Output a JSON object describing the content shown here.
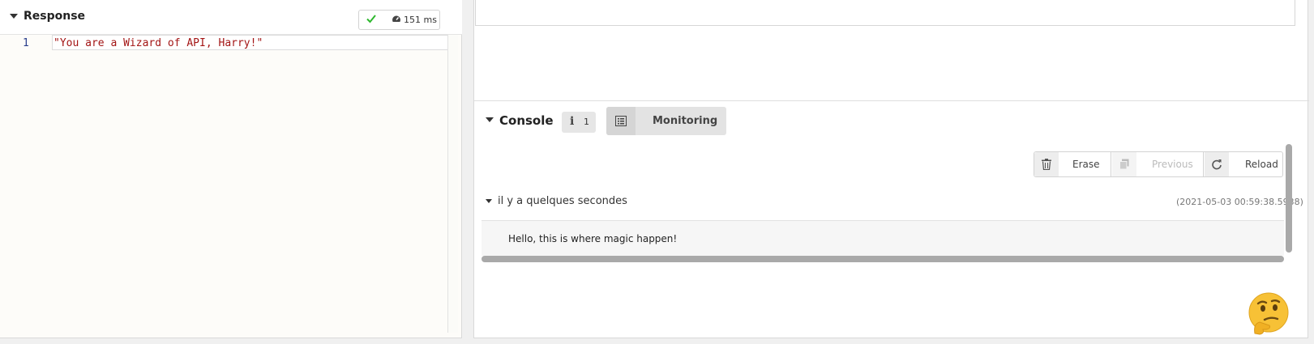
{
  "response": {
    "title": "Response",
    "timing": "151 ms",
    "line_number": "1",
    "code": "\"You are a Wizard of API, Harry!\""
  },
  "console": {
    "title": "Console",
    "info_count": "1",
    "info_icon": "info-icon",
    "monitoring_label": "Monitoring",
    "actions": {
      "erase": "Erase",
      "previous": "Previous",
      "reload": "Reload"
    },
    "log": {
      "relative_time": "il y a quelques secondes",
      "timestamp": "(2021-05-03 00:59:38.5938)",
      "message": "Hello, this is where magic happen!"
    }
  },
  "colors": {
    "success_check": "#2eb82e",
    "string_literal": "#a31515",
    "line_number": "#2a3e8c"
  },
  "icons": [
    "check-icon",
    "gauge-icon",
    "list-icon",
    "trash-icon",
    "copy-icon",
    "refresh-icon",
    "thinking-face-emoji"
  ]
}
